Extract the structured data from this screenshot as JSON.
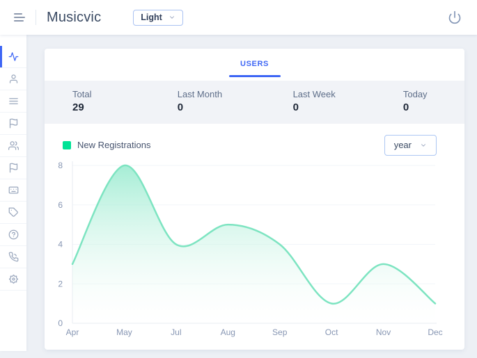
{
  "header": {
    "title": "Musicvic",
    "theme_value": "Light"
  },
  "sidebar": {
    "items": [
      {
        "icon": "activity",
        "active": true
      },
      {
        "icon": "user",
        "active": false
      },
      {
        "icon": "list",
        "active": false
      },
      {
        "icon": "flag",
        "active": false
      },
      {
        "icon": "users",
        "active": false
      },
      {
        "icon": "flag",
        "active": false
      },
      {
        "icon": "keyboard",
        "active": false
      },
      {
        "icon": "tag",
        "active": false
      },
      {
        "icon": "help",
        "active": false
      },
      {
        "icon": "phone",
        "active": false
      },
      {
        "icon": "badge",
        "active": false
      }
    ]
  },
  "tabs": [
    {
      "label": "USERS",
      "active": true
    }
  ],
  "stats": [
    {
      "label": "Total",
      "value": "29"
    },
    {
      "label": "Last Month",
      "value": "0"
    },
    {
      "label": "Last Week",
      "value": "0"
    },
    {
      "label": "Today",
      "value": "0"
    }
  ],
  "chart": {
    "legend_label": "New Registrations",
    "range_value": "year"
  },
  "chart_data": {
    "type": "area",
    "curve": "smooth",
    "categories": [
      "Apr",
      "May",
      "Jul",
      "Aug",
      "Sep",
      "Oct",
      "Nov",
      "Dec"
    ],
    "series": [
      {
        "name": "New Registrations",
        "values": [
          3,
          8,
          4,
          5,
          4,
          1,
          3,
          1
        ]
      }
    ],
    "title": "",
    "xlabel": "",
    "ylabel": "",
    "ylim": [
      0,
      8
    ],
    "yticks": [
      0,
      2,
      4,
      6,
      8
    ],
    "grid": true,
    "legend_position": "top-left",
    "colors": {
      "marker": "#00E396",
      "stroke": "#7DE4C1",
      "fill_top": "#8FE9CB",
      "fill_bottom": "#FFFFFF"
    }
  },
  "colors": {
    "accent_blue": "#3E66F5",
    "page_bg": "#EDF0F5",
    "stats_bg": "#F1F3F7",
    "icon_gray": "#9AA7BD",
    "axis_label": "#8796B3"
  }
}
